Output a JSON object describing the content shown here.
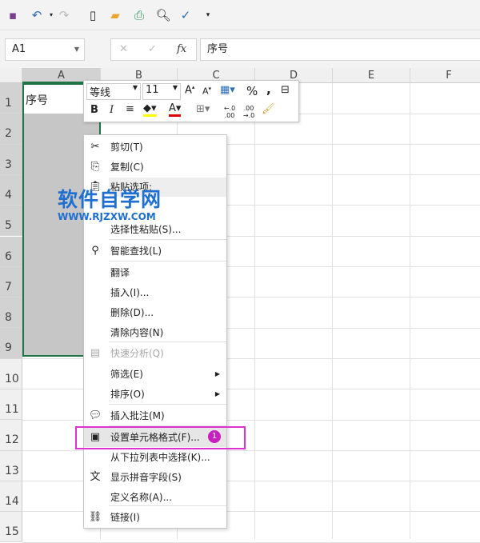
{
  "name_box": {
    "value": "A1"
  },
  "formula_bar": {
    "fx": "fx",
    "content": "序号"
  },
  "columns": [
    "A",
    "B",
    "C",
    "D",
    "E",
    "F"
  ],
  "rows": [
    "1",
    "2",
    "3",
    "4",
    "5",
    "6",
    "7",
    "8",
    "9",
    "10",
    "11",
    "12",
    "13",
    "14",
    "15"
  ],
  "cell_a1": "序号",
  "mini_toolbar": {
    "font": "等线",
    "size": "11",
    "percent": "%",
    "comma": ",",
    "bold": "B",
    "italic": "I",
    "inc_decimal": "←.0 .00",
    "dec_decimal": ".00 →.0"
  },
  "context_menu": [
    {
      "label": "剪切(T)",
      "icon": "scissors-icon"
    },
    {
      "label": "复制(C)",
      "icon": "copy-icon"
    },
    {
      "label": "粘贴选项:",
      "icon": "paste-icon"
    },
    {
      "label": "选择性粘贴(S)..."
    },
    {
      "label": "智能查找(L)",
      "icon": "smart-lookup-icon"
    },
    {
      "label": "翻译"
    },
    {
      "label": "插入(I)..."
    },
    {
      "label": "删除(D)..."
    },
    {
      "label": "清除内容(N)"
    },
    {
      "label": "快速分析(Q)",
      "icon": "quick-analysis-icon",
      "disabled": true
    },
    {
      "label": "筛选(E)",
      "submenu": true
    },
    {
      "label": "排序(O)",
      "submenu": true
    },
    {
      "label": "插入批注(M)",
      "icon": "comment-icon"
    },
    {
      "label": "设置单元格格式(F)...",
      "icon": "format-cells-icon",
      "highlighted": true
    },
    {
      "label": "从下拉列表中选择(K)..."
    },
    {
      "label": "显示拼音字段(S)",
      "icon": "phonetic-icon"
    },
    {
      "label": "定义名称(A)..."
    },
    {
      "label": "链接(I)",
      "icon": "link-icon"
    }
  ],
  "annotation_badge": "1",
  "watermark": {
    "title": "软件自学网",
    "url": "WWW.RJZXW.COM"
  },
  "colors": {
    "accent": "#217346",
    "highlight": "#e030d0"
  }
}
